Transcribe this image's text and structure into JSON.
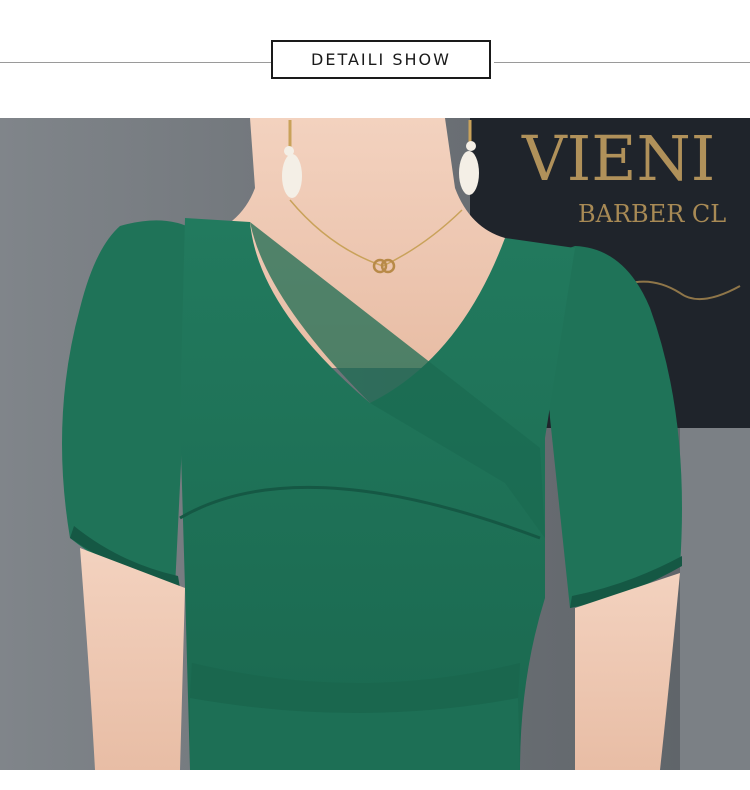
{
  "header": {
    "title": "DETAILI SHOW"
  },
  "photo": {
    "sign_line1": "VIENI",
    "sign_line2": "BARBER CL",
    "colors": {
      "dress": "#1f7358",
      "dress_shadow": "#155844",
      "skin": "#efc8b2",
      "background_wall": "#6f7479",
      "sign_panel": "#1f242b",
      "sign_gold": "#b0915a"
    }
  }
}
